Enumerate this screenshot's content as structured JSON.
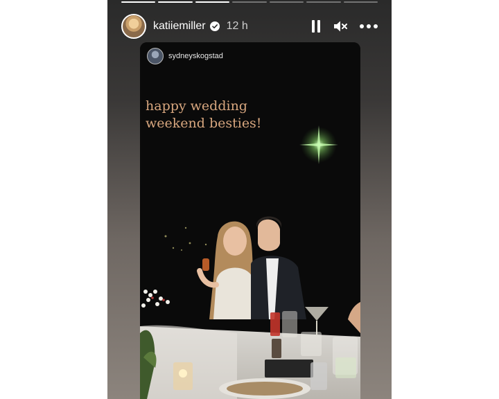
{
  "story": {
    "username": "katiiemiller",
    "time": "12 h",
    "verified": true,
    "segments_total": 7,
    "segments_done": 3,
    "controls": [
      "pause-icon",
      "mute-icon",
      "more-icon"
    ]
  },
  "repost": {
    "username": "sydneyskogstad",
    "caption_lines": [
      "happy wedding",
      "weekend besties!"
    ]
  },
  "colors": {
    "caption": "#d8a77f",
    "background": "#ffffff",
    "progress_done": "#ffffff"
  }
}
